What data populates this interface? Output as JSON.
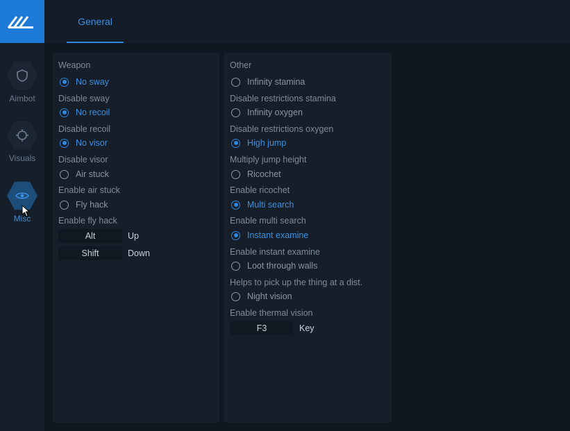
{
  "sidebar": {
    "items": [
      {
        "label": "Aimbot",
        "icon": "shield-icon",
        "active": false
      },
      {
        "label": "Visuals",
        "icon": "crosshair-icon",
        "active": false
      },
      {
        "label": "Misc",
        "icon": "eye-icon",
        "active": true
      }
    ]
  },
  "tabs": [
    {
      "label": "General",
      "active": true
    }
  ],
  "left_panel": {
    "heading": "Weapon",
    "options": [
      {
        "label": "No sway",
        "checked": true,
        "desc": "Disable sway"
      },
      {
        "label": "No recoil",
        "checked": true,
        "desc": "Disable recoil"
      },
      {
        "label": "No visor",
        "checked": true,
        "desc": "Disable visor"
      },
      {
        "label": "Air stuck",
        "checked": false,
        "desc": "Enable air stuck"
      },
      {
        "label": "Fly hack",
        "checked": false,
        "desc": "Enable fly hack"
      }
    ],
    "keybinds": [
      {
        "key": "Alt",
        "action": "Up"
      },
      {
        "key": "Shift",
        "action": "Down"
      }
    ]
  },
  "right_panel": {
    "heading": "Other",
    "options": [
      {
        "label": "Infinity stamina",
        "checked": false,
        "desc": "Disable restrictions stamina"
      },
      {
        "label": "Infinity oxygen",
        "checked": false,
        "desc": "Disable restrictions oxygen"
      },
      {
        "label": "High jump",
        "checked": true,
        "desc": "Multiply jump height"
      },
      {
        "label": "Ricochet",
        "checked": false,
        "desc": "Enable ricochet"
      },
      {
        "label": "Multi search",
        "checked": true,
        "desc": "Enable multi search"
      },
      {
        "label": "Instant examine",
        "checked": true,
        "desc": "Enable instant examine"
      },
      {
        "label": "Loot through walls",
        "checked": false,
        "desc": "Helps to pick up the thing at a dist."
      },
      {
        "label": "Night vision",
        "checked": false,
        "desc": "Enable thermal vision"
      }
    ],
    "keybinds": [
      {
        "key": "F3",
        "action": "Key"
      }
    ]
  },
  "colors": {
    "accent": "#2e86de",
    "logo_bg": "#1d7ad6",
    "panel_bg": "#161e29",
    "background": "#0f1721"
  }
}
